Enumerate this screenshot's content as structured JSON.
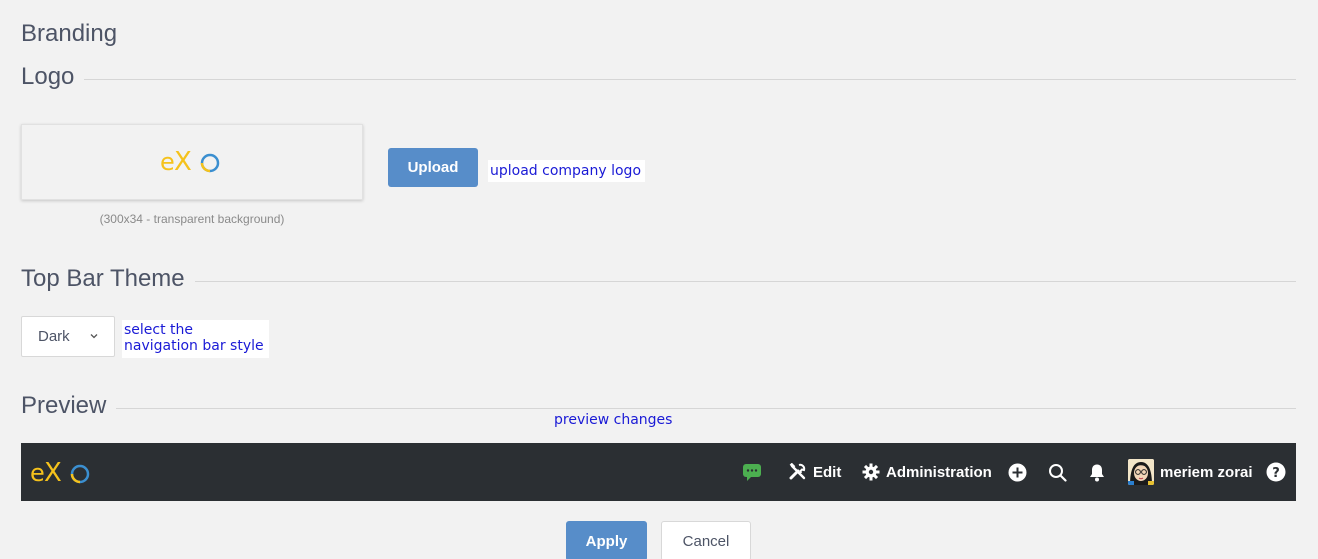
{
  "page": {
    "title": "Branding"
  },
  "logo_section": {
    "heading": "Logo",
    "logo_text": "eXo",
    "caption": "(300x34 - transparent background)",
    "upload_label": "Upload",
    "upload_hint": "upload company logo"
  },
  "theme_section": {
    "heading": "Top Bar Theme",
    "selected_value": "Dark",
    "hint": "select the navigation bar style"
  },
  "preview_section": {
    "heading": "Preview",
    "hint": "preview changes"
  },
  "topbar": {
    "background": "#2b2f33",
    "brand_text": "eXo",
    "items": {
      "chat_icon": "chat-bubble-icon",
      "edit_label": "Edit",
      "admin_label": "Administration",
      "user_name": "meriem zorai"
    }
  },
  "actions": {
    "apply_label": "Apply",
    "cancel_label": "Cancel"
  },
  "colors": {
    "accent": "#578dc9",
    "logo_yellow": "#f5c21c",
    "logo_blue": "#3b8fd0",
    "chat_green": "#4caf50",
    "hint_blue": "#1a1ad6"
  }
}
